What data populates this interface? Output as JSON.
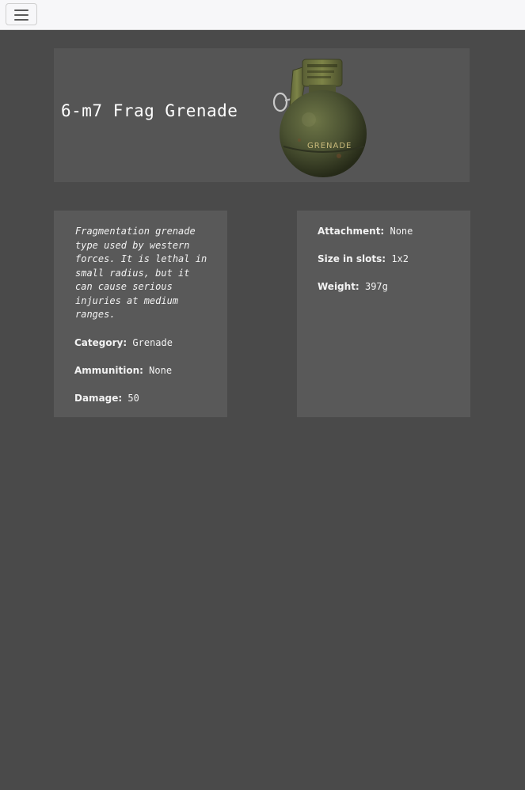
{
  "item": {
    "title": "6-m7 Frag Grenade",
    "description": "Fragmentation grenade type used by western forces. It is lethal in small radius, but it can cause serious injuries at medium ranges.",
    "grenade_text": "GRENADE"
  },
  "left_specs": [
    {
      "label": "Category:",
      "value": "Grenade"
    },
    {
      "label": "Ammunition:",
      "value": "None"
    },
    {
      "label": "Damage:",
      "value": "50"
    }
  ],
  "right_specs": [
    {
      "label": "Attachment:",
      "value": "None"
    },
    {
      "label": "Size in slots:",
      "value": "1x2"
    },
    {
      "label": "Weight:",
      "value": "397g"
    }
  ],
  "colors": {
    "background": "#4a4a4a",
    "panel": "#555555",
    "navbar": "#f7f7f9",
    "grenade_body": "#4b5232"
  }
}
